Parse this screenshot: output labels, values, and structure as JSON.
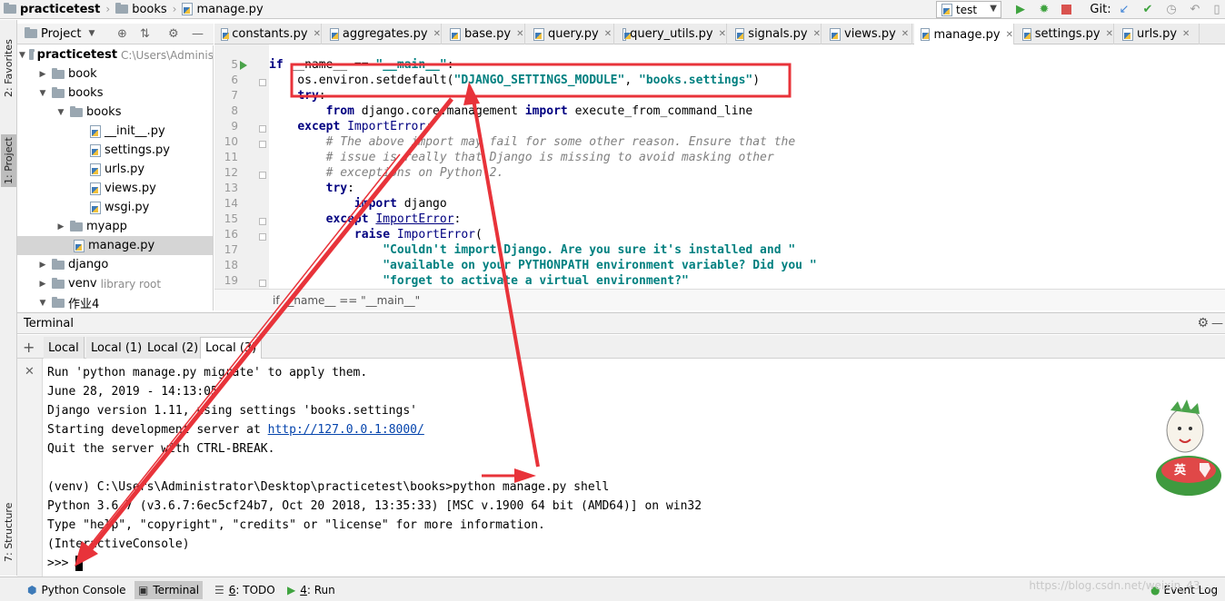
{
  "navbar": {
    "crumbs": [
      "practicetest",
      "books",
      "manage.py"
    ],
    "run_config": "test",
    "git_label": "Git:"
  },
  "left_strip": {
    "favorites": "2: Favorites",
    "project": "1: Project",
    "structure": "7: Structure"
  },
  "project_panel": {
    "title": "Project",
    "tree": [
      {
        "label": "practicetest",
        "hint": "C:\\Users\\Adminis"
      },
      {
        "label": "book"
      },
      {
        "label": "books"
      },
      {
        "label": "books"
      },
      {
        "label": "__init__.py"
      },
      {
        "label": "settings.py"
      },
      {
        "label": "urls.py"
      },
      {
        "label": "views.py"
      },
      {
        "label": "wsgi.py"
      },
      {
        "label": "myapp"
      },
      {
        "label": "manage.py"
      },
      {
        "label": "django"
      },
      {
        "label": "venv",
        "hint": "library root"
      },
      {
        "label": "作业4"
      }
    ]
  },
  "editor_tabs": [
    "constants.py",
    "aggregates.py",
    "base.py",
    "query.py",
    "query_utils.py",
    "signals.py",
    "views.py",
    "manage.py",
    "settings.py",
    "urls.py"
  ],
  "editor": {
    "line_numbers": [
      "5",
      "6",
      "7",
      "8",
      "9",
      "10",
      "11",
      "12",
      "13",
      "14",
      "15",
      "16",
      "17",
      "18",
      "19"
    ],
    "breadcrumb": "if __name__ == \"__main__\""
  },
  "terminal": {
    "title": "Terminal",
    "tabs": [
      "Local",
      "Local (1)",
      "Local (2)",
      "Local (3)"
    ],
    "lines": [
      "Run 'python manage.py migrate' to apply them.",
      "June 28, 2019 - 14:13:05",
      "Django version 1.11, using settings 'books.settings'",
      "Quit the server with CTRL-BREAK.",
      "",
      "(venv) C:\\Users\\Administrator\\Desktop\\practicetest\\books>python manage.py shell",
      "Python 3.6.7 (v3.6.7:6ec5cf24b7, Oct 20 2018, 13:35:33) [MSC v.1900 64 bit (AMD64)] on win32",
      "Type \"help\", \"copyright\", \"credits\" or \"license\" for more information.",
      "(InteractiveConsole)"
    ],
    "server_line_prefix": "Starting development server at ",
    "server_url": "http://127.0.0.1:8000/",
    "prompt": ">>> "
  },
  "bottom_bar": {
    "python_console": "Python Console",
    "terminal": "Terminal",
    "todo_num": "6",
    "todo_text": ": TODO",
    "run_num": "4",
    "run_text": ": Run",
    "event_log": "Event Log",
    "watermark": "https://blog.csdn.net/weixin_43..."
  },
  "mascot_label": "英",
  "colors": {
    "annotation": "#e8333a",
    "keyword": "#000080",
    "string": "#008080",
    "comment": "#808080"
  }
}
